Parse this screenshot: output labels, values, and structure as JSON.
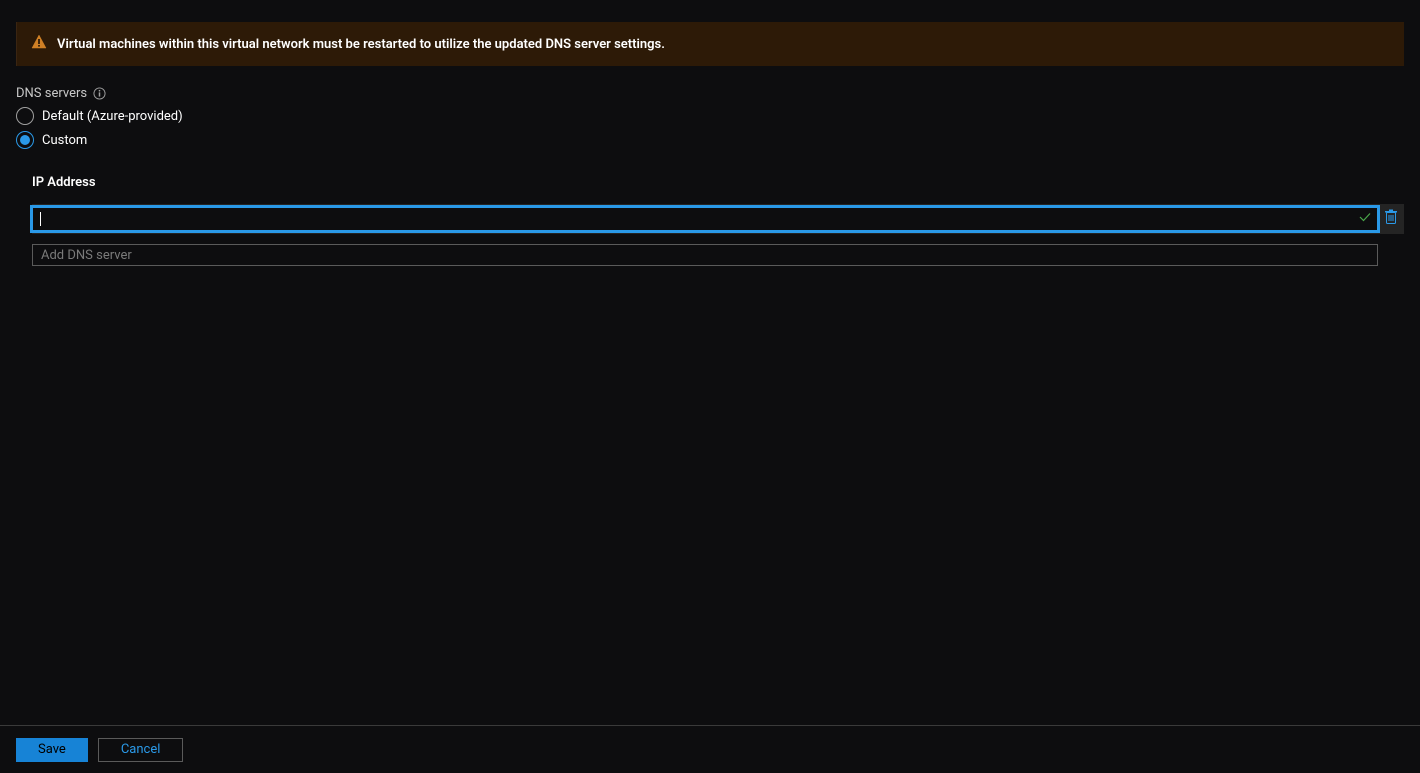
{
  "warning": {
    "message": "Virtual machines within this virtual network must be restarted to utilize the updated DNS server settings."
  },
  "dnsSection": {
    "label": "DNS servers",
    "options": {
      "default": "Default (Azure-provided)",
      "custom": "Custom"
    },
    "selected": "custom",
    "ipAddressHeader": "IP Address",
    "inputs": {
      "primary": {
        "value": "",
        "placeholder": ""
      },
      "add": {
        "placeholder": "Add DNS server"
      }
    }
  },
  "footer": {
    "save": "Save",
    "cancel": "Cancel"
  }
}
